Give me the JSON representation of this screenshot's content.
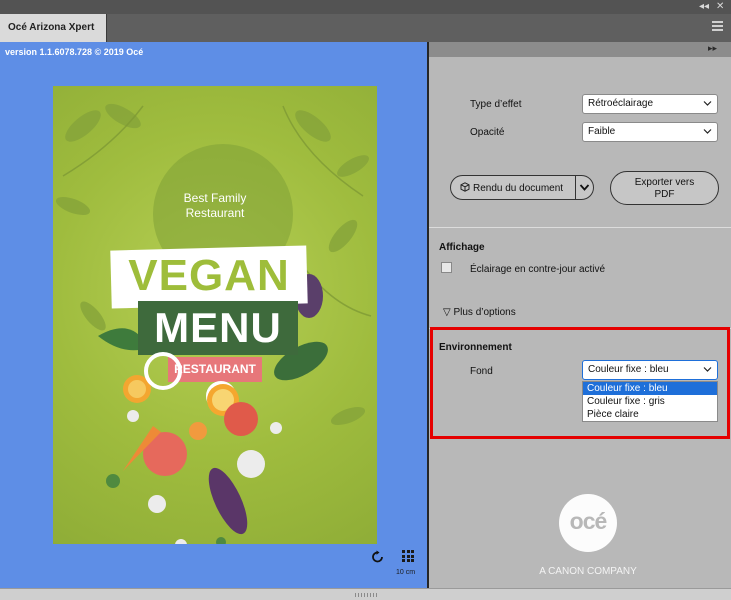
{
  "window": {
    "collapse_glyph": "◂◂",
    "close_glyph": "✕"
  },
  "tab": {
    "title": "Océ Arizona Xpert",
    "menu_icon": "hamburger-menu-icon"
  },
  "preview": {
    "version": "version 1.1.6078.728 © 2019 Océ",
    "poster": {
      "tagline_line1": "Best Family",
      "tagline_line2": "Restaurant",
      "word1": "VEGAN",
      "word2": "MENU",
      "word3": "RESTAURANT"
    },
    "scale_label": "10 cm",
    "rotate_icon": "rotate-icon",
    "grid_icon": "grid-icon"
  },
  "settings": {
    "header_collapse": "▸▸",
    "effect_type_label": "Type d’effet",
    "effect_type_value": "Rétroéclairage",
    "opacity_label": "Opacité",
    "opacity_value": "Faible",
    "render_button": "Rendu du document",
    "export_button_line1": "Exporter vers",
    "export_button_line2": "PDF"
  },
  "display": {
    "title": "Affichage",
    "backlight_checkbox_label": "Éclairage en contre-jour activé",
    "backlight_checked": false,
    "more_options": "▽ Plus d’options"
  },
  "environment": {
    "title": "Environnement",
    "background_label": "Fond",
    "background_value": "Couleur fixe : bleu",
    "options": [
      "Couleur fixe : bleu",
      "Couleur fixe : gris",
      "Pièce claire"
    ],
    "selected_index": 0,
    "highlight_color": "#e50000"
  },
  "brand": {
    "logo": "océ",
    "tagline": "A CANON COMPANY"
  },
  "colors": {
    "preview_bg": "#5e8ee6",
    "selection": "#1e6fd9",
    "panel_bg": "#b8b8b8"
  }
}
